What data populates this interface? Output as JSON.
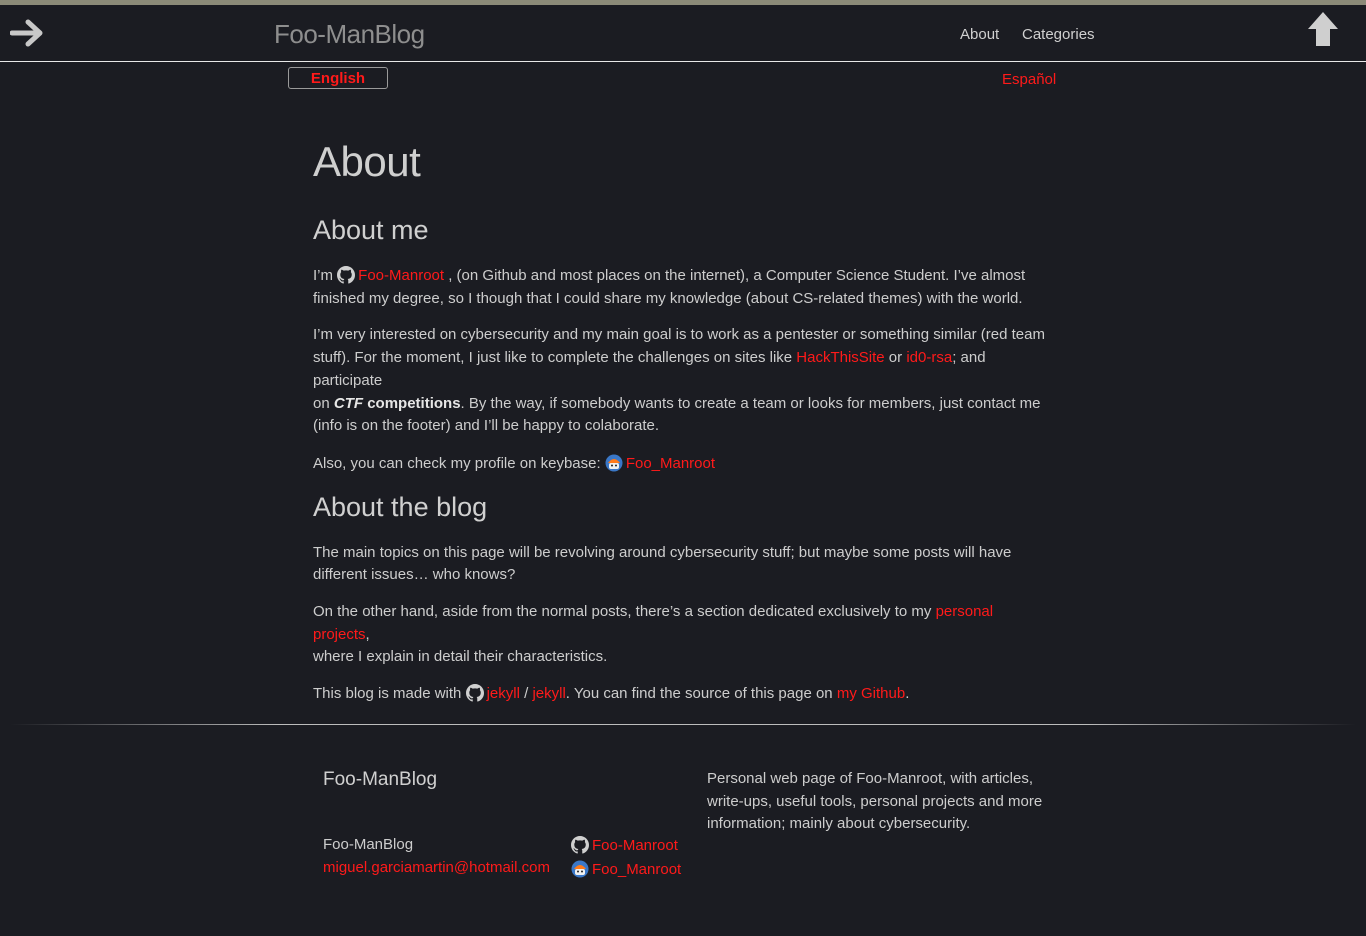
{
  "header": {
    "site_title": "Foo-ManBlog",
    "nav": [
      {
        "label": "About"
      },
      {
        "label": "Categories"
      }
    ]
  },
  "languages": {
    "english": "English",
    "spanish": "Español"
  },
  "about": {
    "title": "About",
    "about_me_heading": "About me",
    "p1": {
      "pre": "I’m ",
      "github_user": "Foo-Manroot",
      "post_line1": " , (on Github and most places on the internet), a Computer Science Student. I’ve almost",
      "line2": "finished my degree, so I though that I could share my knowledge (about CS-related themes) with the world."
    },
    "p2": {
      "line1": "I’m very interested on cybersecurity and my main goal is to work as a pentester or something similar (red team",
      "line2_pre": "stuff). For the moment, I just like to complete the challenges on sites like ",
      "link1": "HackThisSite",
      "mid": " or ",
      "link2": "id0-rsa",
      "line2_post": "; and participate",
      "line3_pre": "on ",
      "ctf": "CTF",
      "competitions": " competitions",
      "line3_post": ". By the way, if somebody wants to create a team or looks for members, just contact me",
      "line4": "(info is on the footer) and I’ll be happy to colaborate."
    },
    "p3": {
      "pre": "Also, you can check my profile on keybase: ",
      "keybase_user": "Foo_Manroot"
    },
    "about_blog_heading": "About the blog",
    "p4": {
      "line1": "The main topics on this page will be revolving around cybersecurity stuff; but maybe some posts will have",
      "line2": "different issues… who knows?"
    },
    "p5": {
      "line1_pre": "On the other hand, aside from the normal posts, there’s a section dedicated exclusively to my ",
      "link": "personal projects",
      "line1_post": ",",
      "line2": "where I explain in detail their characteristics."
    },
    "p6": {
      "pre": "This blog is made with ",
      "link_a": "jekyll",
      "sep": " / ",
      "link_b": "jekyll",
      "mid": ". You can find the source of this page on ",
      "link_c": "my Github",
      "post": "."
    }
  },
  "footer": {
    "title": "Foo-ManBlog",
    "name": "Foo-ManBlog",
    "email": "miguel.garciamartin@hotmail.com",
    "github_user": "Foo-Manroot",
    "keybase_user": "Foo_Manroot",
    "description": "Personal web page of Foo-Manroot, with articles, write-ups, useful tools, personal projects and more information; mainly about cybersecurity."
  },
  "icons": {
    "back": "arrow-right-icon",
    "up": "arrow-up-icon",
    "github": "github-icon",
    "keybase": "keybase-icon"
  },
  "colors": {
    "background": "#1b1c22",
    "accent": "#ff1a1a",
    "top_strip": "#8b8a78"
  }
}
